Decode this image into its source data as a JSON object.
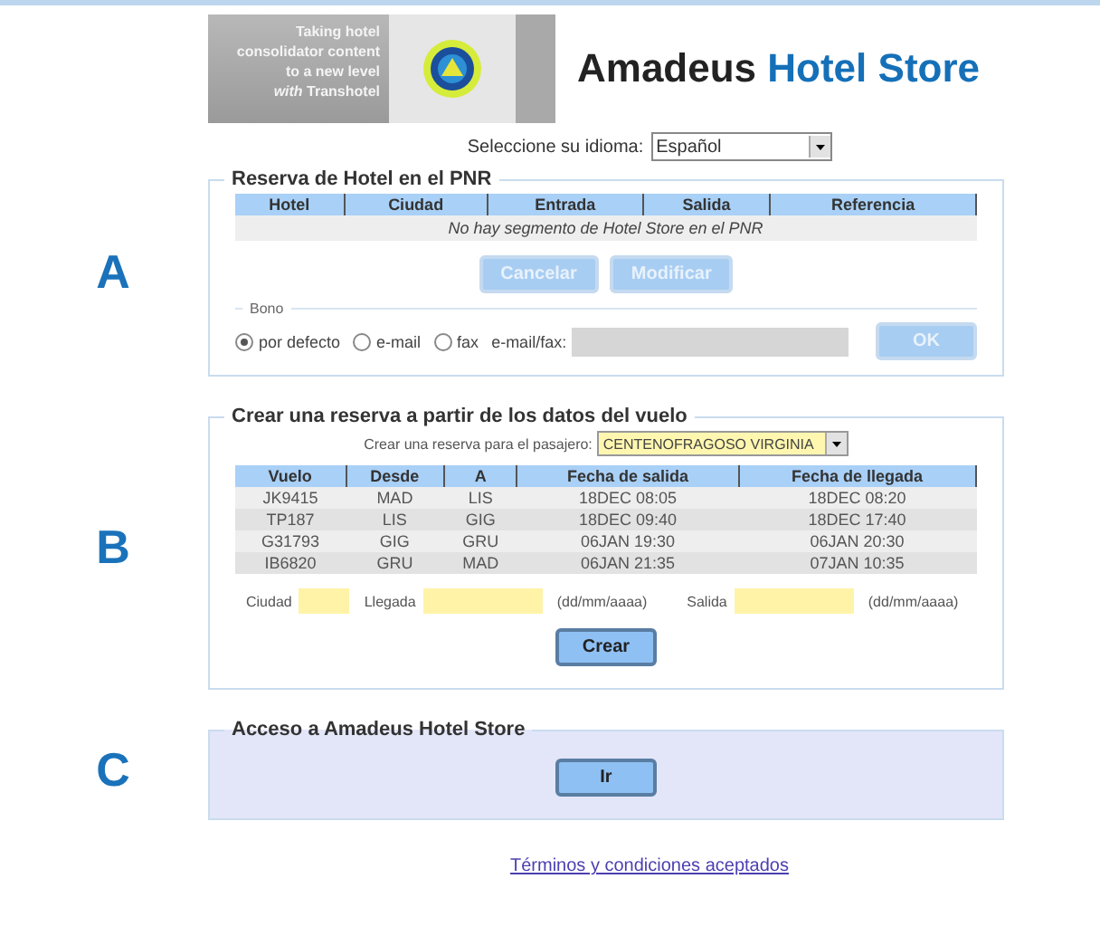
{
  "banner": {
    "promo_lines": [
      "Taking hotel",
      "consolidator content",
      "to a new level",
      "*with* Transhotel"
    ],
    "title_parts": [
      {
        "text": "Amadeus",
        "kind": "dark"
      },
      {
        "text": "Hotel Store",
        "kind": "accent"
      }
    ]
  },
  "language": {
    "label": "Seleccione su idioma:",
    "value": "Español"
  },
  "section_a": {
    "letter": "A",
    "legend": "Reserva de Hotel en el PNR",
    "columns": [
      "Hotel",
      "Ciudad",
      "Entrada",
      "Salida",
      "Referencia"
    ],
    "empty_message": "No hay segmento de Hotel Store en el PNR",
    "buttons": [
      {
        "label": "Cancelar",
        "disabled": true
      },
      {
        "label": "Modificar",
        "disabled": true
      }
    ],
    "bono": {
      "legend": "Bono",
      "radios": [
        {
          "label": "por defecto",
          "selected": true
        },
        {
          "label": "e-mail",
          "selected": false
        },
        {
          "label": "fax",
          "selected": false
        }
      ],
      "field_label": "e-mail/fax:",
      "ok": {
        "label": "OK",
        "disabled": true
      }
    }
  },
  "section_b": {
    "letter": "B",
    "legend": "Crear una reserva a partir de los datos del vuelo",
    "passenger_label": "Crear una reserva para el pasajero:",
    "passenger_value": "CENTENOFRAGOSO VIRGINIA",
    "columns": [
      "Vuelo",
      "Desde",
      "A",
      "Fecha de salida",
      "Fecha de llegada"
    ],
    "rows": [
      [
        "JK9415",
        "MAD",
        "LIS",
        "18DEC 08:05",
        "18DEC 08:20"
      ],
      [
        "TP187",
        "LIS",
        "GIG",
        "18DEC 09:40",
        "18DEC 17:40"
      ],
      [
        "G31793",
        "GIG",
        "GRU",
        "06JAN 19:30",
        "06JAN 20:30"
      ],
      [
        "IB6820",
        "GRU",
        "MAD",
        "06JAN 21:35",
        "07JAN 10:35"
      ]
    ],
    "fields": [
      {
        "label": "Ciudad",
        "kind": "short"
      },
      {
        "label": "Llegada",
        "kind": "date",
        "hint": "(dd/mm/aaaa)"
      },
      {
        "label": "Salida",
        "kind": "date",
        "hint": "(dd/mm/aaaa)"
      }
    ],
    "button": "Crear"
  },
  "section_c": {
    "letter": "C",
    "legend": "Acceso a Amadeus Hotel Store",
    "button": "Ir"
  },
  "footer_link": "Términos y condiciones aceptados"
}
